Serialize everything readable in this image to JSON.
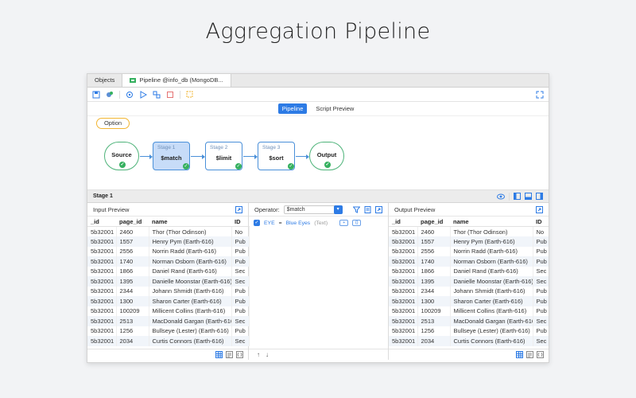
{
  "headline": "Aggregation Pipeline",
  "tabs": [
    {
      "label": "Objects"
    },
    {
      "label": "Pipeline @info_db (MongoDB..."
    }
  ],
  "subtabs": [
    "Pipeline",
    "Script Preview"
  ],
  "option_label": "Option",
  "nodes": {
    "source": "Source",
    "output": "Output",
    "stages": [
      {
        "stage": "Stage 1",
        "name": "$match"
      },
      {
        "stage": "Stage 2",
        "name": "$limit"
      },
      {
        "stage": "Stage 3",
        "name": "$sort"
      }
    ]
  },
  "stage_bar": {
    "label": "Stage 1"
  },
  "input_preview": {
    "title": "Input Preview"
  },
  "output_preview": {
    "title": "Output Preview"
  },
  "operator": {
    "label": "Operator:",
    "value": "$match"
  },
  "condition": {
    "field": "EYE",
    "op": "=",
    "value": "Blue Eyes",
    "type": "(Text)"
  },
  "table": {
    "columns": [
      "_id",
      "page_id",
      "name",
      "ID"
    ],
    "rows": [
      [
        "5b32001",
        "2460",
        "Thor (Thor Odinson)",
        "No"
      ],
      [
        "5b32001",
        "1557",
        "Henry Pym (Earth-616)",
        "Pub"
      ],
      [
        "5b32001",
        "2556",
        "Norrin Radd (Earth-616)",
        "Pub"
      ],
      [
        "5b32001",
        "1740",
        "Norman Osborn (Earth-616)",
        "Pub"
      ],
      [
        "5b32001",
        "1866",
        "Daniel Rand (Earth-616)",
        "Sec"
      ],
      [
        "5b32001",
        "1395",
        "Danielle Moonstar (Earth-616)",
        "Sec"
      ],
      [
        "5b32001",
        "2344",
        "Johann Shmidt (Earth-616)",
        "Pub"
      ],
      [
        "5b32001",
        "1300",
        "Sharon Carter (Earth-616)",
        "Pub"
      ],
      [
        "5b32001",
        "100209",
        "Millicent Collins (Earth-616)",
        "Pub"
      ],
      [
        "5b32001",
        "2513",
        "MacDonald Gargan (Earth-616)",
        "Sec"
      ],
      [
        "5b32001",
        "1256",
        "Bullseye (Lester) (Earth-616)",
        "Pub"
      ],
      [
        "5b32001",
        "2034",
        "Curtis Connors (Earth-616)",
        "Sec"
      ]
    ]
  },
  "colors": {
    "accent": "#2d7be5",
    "success": "#35b05f",
    "option_border": "#f2b531"
  }
}
